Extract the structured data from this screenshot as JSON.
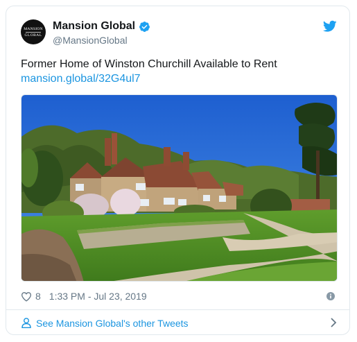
{
  "author": {
    "display_name": "Mansion Global",
    "handle": "@MansionGlobal",
    "avatar_text_line1": "MANSION",
    "avatar_text_line2": "GLOBAL",
    "verified_icon": "verified-badge-icon"
  },
  "tweet": {
    "text": "Former Home of Winston Churchill Available to Rent",
    "link": "mansion.global/32G4ul7"
  },
  "media": {
    "description_icon": "photo-of-country-house"
  },
  "meta": {
    "like_count": "8",
    "timestamp": "1:33 PM - Jul 23, 2019"
  },
  "footer": {
    "see_more_label": "See Mansion Global's other Tweets"
  },
  "colors": {
    "link_blue": "#1b95e0",
    "muted_gray": "#657786",
    "border": "#e1e8ed",
    "twitter_blue": "#1da1f2"
  }
}
